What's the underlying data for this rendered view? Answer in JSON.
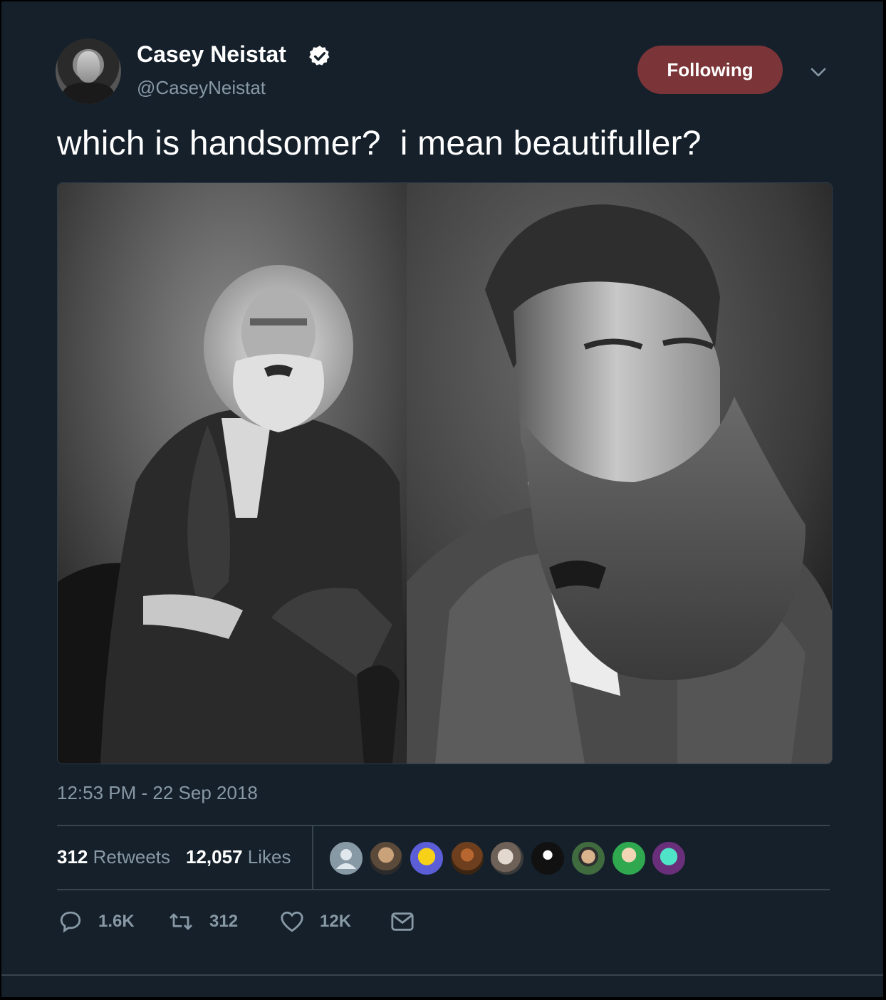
{
  "tweet": {
    "author": {
      "display_name": "Casey Neistat",
      "handle": "@CaseyNeistat",
      "verified": true,
      "avatar_icon": "avatar-photo"
    },
    "follow_button_label": "Following",
    "text": "which is handsomer?  i mean beautifuller?",
    "media": {
      "left_image": "karl-marx-portrait-photo",
      "right_image": "friedrich-engels-portrait-photo"
    },
    "timestamp": "12:53 PM - 22 Sep 2018",
    "stats": {
      "retweets_count": "312",
      "retweets_label": "Retweets",
      "likes_count": "12,057",
      "likes_label": "Likes"
    },
    "likers": [
      "default-avatar",
      "user-avatar",
      "simpsons-avatar",
      "user-avatar",
      "user-avatar",
      "user-avatar",
      "user-avatar",
      "user-avatar",
      "user-avatar"
    ],
    "actions": {
      "reply_count": "1.6K",
      "retweet_count": "312",
      "like_count": "12K",
      "reply_icon": "reply-icon",
      "retweet_icon": "retweet-icon",
      "like_icon": "heart-icon",
      "dm_icon": "envelope-icon"
    }
  },
  "colors": {
    "background": "#15202b",
    "following_button": "#7b3437",
    "muted_text": "#8899a6",
    "divider": "#38444d"
  }
}
